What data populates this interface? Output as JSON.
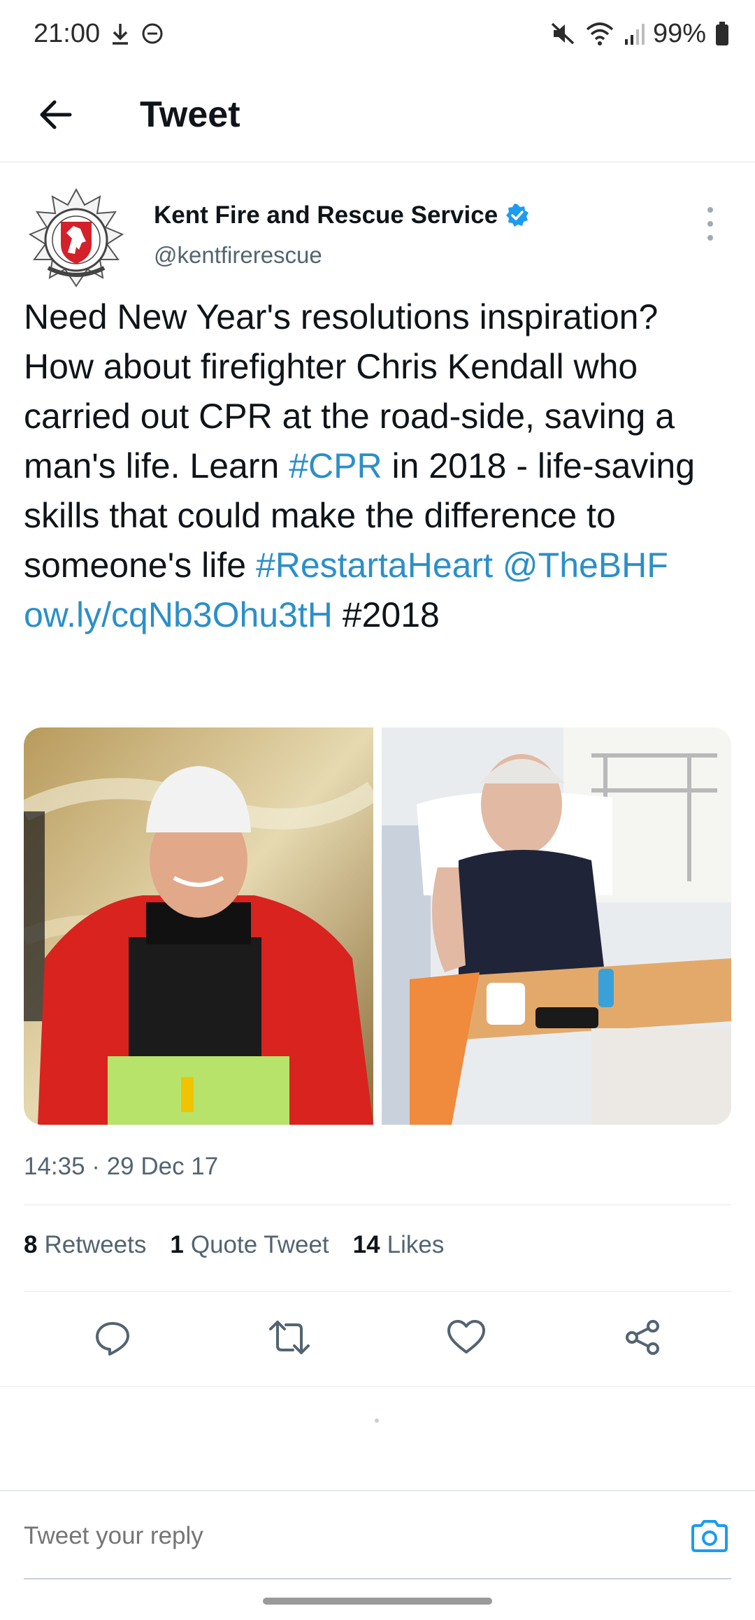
{
  "status_bar": {
    "time": "21:00",
    "battery": "99%",
    "icons": [
      "download-icon",
      "do-not-disturb-icon",
      "mute-icon",
      "wifi-icon",
      "signal-icon",
      "battery-icon"
    ]
  },
  "header": {
    "title": "Tweet",
    "back_icon": "back-arrow-icon"
  },
  "tweet": {
    "author_name": "Kent Fire and Rescue Service",
    "author_handle": "@kentfirerescue",
    "verified": true,
    "text_segments": [
      {
        "text": "Need New Year's resolutions inspiration? How about firefighter Chris Kendall who carried out CPR at the road-side, saving a man's life. Learn ",
        "link": false
      },
      {
        "text": "#CPR",
        "link": true
      },
      {
        "text": " in 2018 - life-saving skills that could make the difference to someone's life ",
        "link": false
      },
      {
        "text": "#RestartaHeart",
        "link": true
      },
      {
        "text": " ",
        "link": false
      },
      {
        "text": "@TheBHF",
        "link": true
      },
      {
        "text": " ",
        "link": false
      },
      {
        "text": "ow.ly/​cqNb3Ohu3tH",
        "link": true
      },
      {
        "text": " #2018",
        "link": false
      }
    ],
    "timestamp": "14:35 · 29 Dec 17",
    "stats": {
      "retweets_count": "8",
      "retweets_label": "Retweets",
      "quotes_count": "1",
      "quotes_label": "Quote Tweet",
      "likes_count": "14",
      "likes_label": "Likes"
    }
  },
  "reply": {
    "placeholder": "Tweet your reply"
  },
  "colors": {
    "link": "#2b8fc9",
    "verified": "#1d9bf0",
    "secondary_text": "#536471"
  }
}
